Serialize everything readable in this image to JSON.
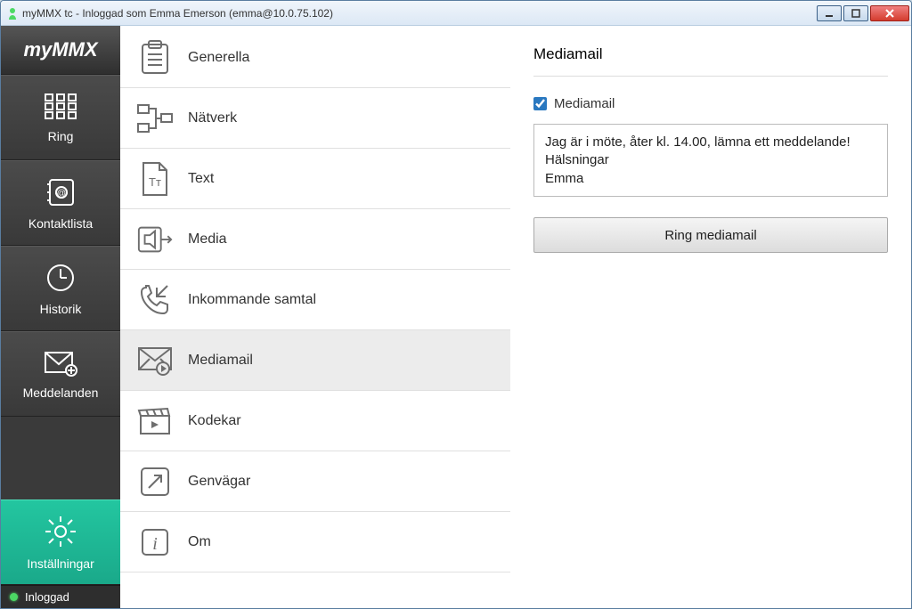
{
  "window": {
    "title": "myMMX tc - Inloggad som Emma Emerson (emma@10.0.75.102)"
  },
  "logo": "myMMX",
  "nav": {
    "items": [
      {
        "label": "Ring"
      },
      {
        "label": "Kontaktlista"
      },
      {
        "label": "Historik"
      },
      {
        "label": "Meddelanden"
      },
      {
        "label": "Inställningar"
      }
    ],
    "status": "Inloggad"
  },
  "settings": {
    "items": [
      {
        "label": "Generella"
      },
      {
        "label": "Nätverk"
      },
      {
        "label": "Text"
      },
      {
        "label": "Media"
      },
      {
        "label": "Inkommande samtal"
      },
      {
        "label": "Mediamail"
      },
      {
        "label": "Kodekar"
      },
      {
        "label": "Genvägar"
      },
      {
        "label": "Om"
      }
    ]
  },
  "detail": {
    "heading": "Mediamail",
    "checkbox_label": "Mediamail",
    "checkbox_checked": true,
    "message": "Jag är i möte, åter kl. 14.00, lämna ett meddelande!\nHälsningar\nEmma",
    "button_label": "Ring mediamail"
  }
}
